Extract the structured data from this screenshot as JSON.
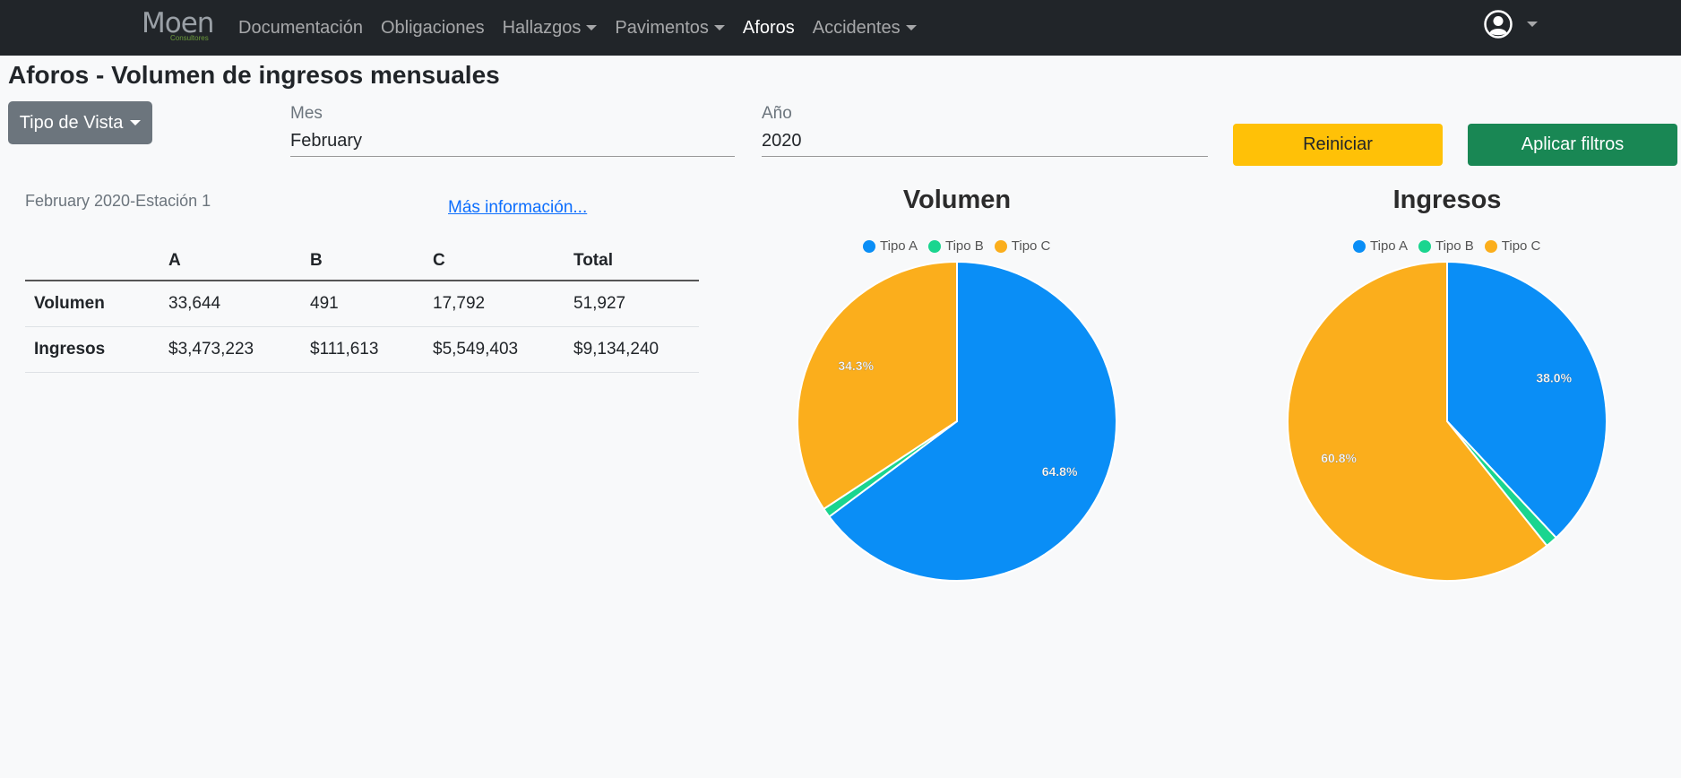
{
  "nav": {
    "logo_text": "Moen",
    "logo_sub": "Consultores",
    "items": [
      {
        "label": "Documentación"
      },
      {
        "label": "Obligaciones"
      },
      {
        "label": "Hallazgos"
      },
      {
        "label": "Pavimentos"
      },
      {
        "label": "Aforos"
      },
      {
        "label": "Accidentes"
      }
    ]
  },
  "page_title": "Aforos - Volumen de ingresos mensuales",
  "filters": {
    "view_button": "Tipo de Vista",
    "month_label": "Mes",
    "month_value": "February",
    "year_label": "Año",
    "year_value": "2020",
    "reset_label": "Reiniciar",
    "apply_label": "Aplicar filtros"
  },
  "summary": {
    "station_label": "February 2020-Estación 1",
    "more_info": "Más información...",
    "headers": [
      "",
      "A",
      "B",
      "C",
      "Total"
    ],
    "rows": [
      {
        "label": "Volumen",
        "a": "33,644",
        "b": "491",
        "c": "17,792",
        "total": "51,927"
      },
      {
        "label": "Ingresos",
        "a": "$3,473,223",
        "b": "$111,613",
        "c": "$5,549,403",
        "total": "$9,134,240"
      }
    ]
  },
  "colors": {
    "tipo_a": "#0a8ef6",
    "tipo_b": "#1ad58f",
    "tipo_c": "#fbae1c"
  },
  "chart_data": [
    {
      "type": "pie",
      "title": "Volumen",
      "legend_position": "top",
      "series": [
        {
          "name": "Tipo A",
          "value": 33644,
          "label": "64.8%"
        },
        {
          "name": "Tipo B",
          "value": 491,
          "label": ""
        },
        {
          "name": "Tipo C",
          "value": 17792,
          "label": "34.3%"
        }
      ]
    },
    {
      "type": "pie",
      "title": "Ingresos",
      "legend_position": "top",
      "series": [
        {
          "name": "Tipo A",
          "value": 3473223,
          "label": "38.0%"
        },
        {
          "name": "Tipo B",
          "value": 111613,
          "label": ""
        },
        {
          "name": "Tipo C",
          "value": 5549403,
          "label": "60.8%"
        }
      ]
    }
  ]
}
